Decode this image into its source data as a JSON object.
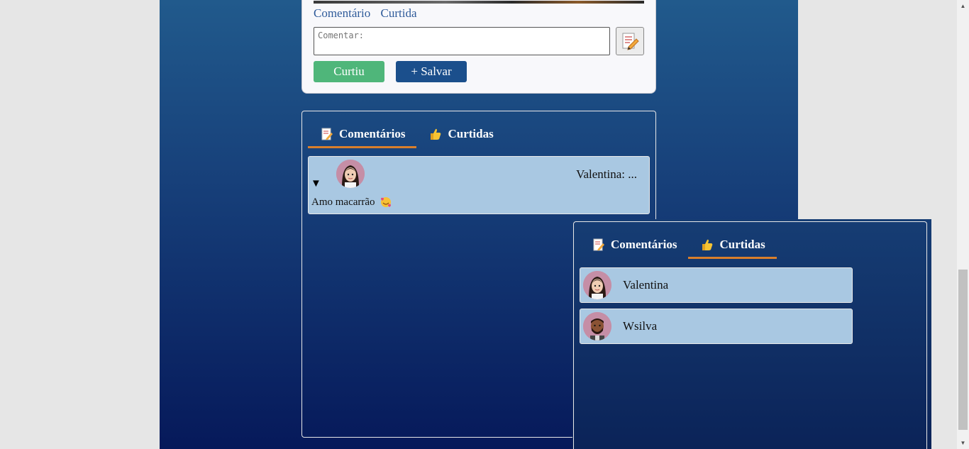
{
  "post": {
    "links": [
      "Comentário",
      "Curtida"
    ],
    "comment_placeholder": "Comentar:",
    "send_icon": "edit-note-icon",
    "liked_label": "Curtiu",
    "save_label": "+ Salvar"
  },
  "comments_panel": {
    "tabs": [
      {
        "label": "Comentários",
        "icon": "memo-icon",
        "active": true
      },
      {
        "label": "Curtidas",
        "icon": "thumbs-up-icon",
        "active": false
      }
    ],
    "items": [
      {
        "toggle": "▼",
        "author": "Valentina: ...",
        "text": "Amo macarrão",
        "emoji": "smiling-face-with-hearts-icon"
      }
    ]
  },
  "likes_panel": {
    "tabs": [
      {
        "label": "Comentários",
        "icon": "memo-icon",
        "active": false
      },
      {
        "label": "Curtidas",
        "icon": "thumbs-up-icon",
        "active": true
      }
    ],
    "items": [
      {
        "name": "Valentina"
      },
      {
        "name": "Wsilva"
      }
    ]
  },
  "colors": {
    "accent_tab": "#d97f2c",
    "liked_button": "#4fb67a",
    "save_button": "#1b4f8c",
    "item_bg": "#a9c8e2"
  }
}
